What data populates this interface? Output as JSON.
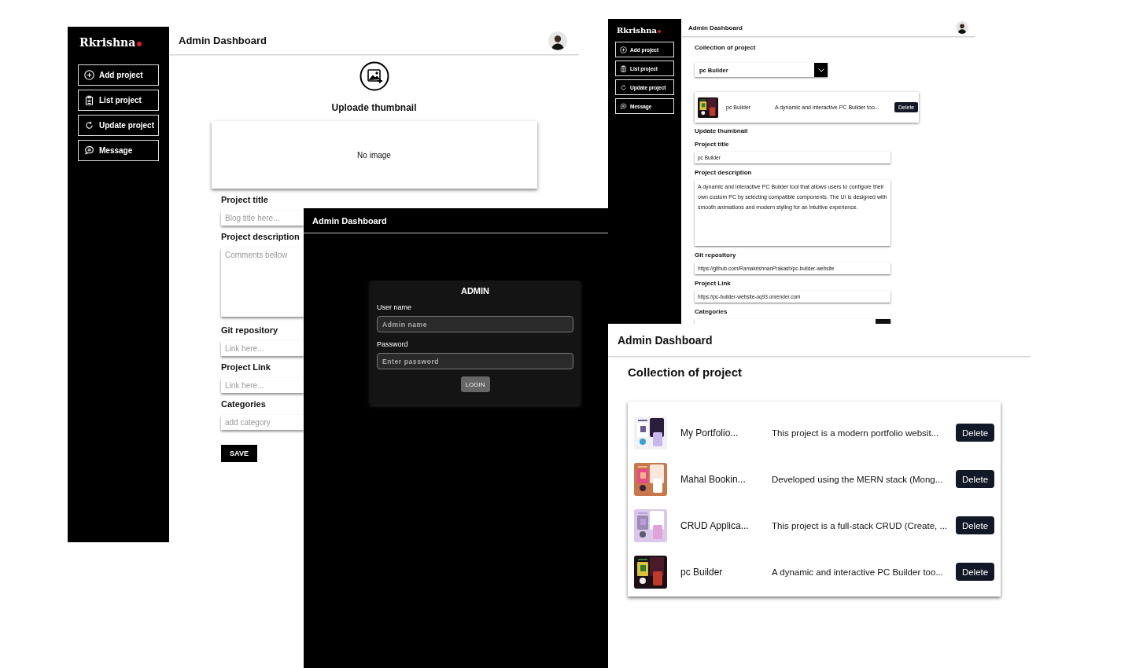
{
  "add_project_screen": {
    "brand": "Rkrishna",
    "sidebar": {
      "items": [
        {
          "label": "Add project"
        },
        {
          "label": "List project"
        },
        {
          "label": "Update project"
        },
        {
          "label": "Message"
        }
      ]
    },
    "title": "Admin Dashboard",
    "upload_label": "Uploade thumbnail",
    "preview": "No image",
    "fields": [
      {
        "label": "Project title",
        "placeholder": "Blog title here...",
        "kind": "input"
      },
      {
        "label": "Project description",
        "placeholder": "Comments bellow",
        "kind": "textarea"
      },
      {
        "label": "Git repository",
        "placeholder": "Link here...",
        "kind": "input"
      },
      {
        "label": "Project Link",
        "placeholder": "Link here...",
        "kind": "input"
      },
      {
        "label": "Categories",
        "placeholder": "add category",
        "kind": "input"
      }
    ],
    "save_button": "SAVE"
  },
  "login_screen": {
    "title": "Admin Dashboard",
    "heading": "ADMIN",
    "fields": [
      {
        "label": "User name",
        "placeholder": "Admin name"
      },
      {
        "label": "Password",
        "placeholder": "Enter password"
      }
    ],
    "button": "LOGIN"
  },
  "update_screen": {
    "brand": "Rkrishna",
    "sidebar": {
      "items": [
        {
          "label": "Add project"
        },
        {
          "label": "List project"
        },
        {
          "label": "Update project"
        },
        {
          "label": "Message"
        }
      ]
    },
    "title": "Admin Dashboard",
    "section": "Collection of project",
    "select": {
      "value": "pc Builder"
    },
    "project_card": {
      "title": "pc Builder",
      "description": "A dynamic and interactive PC Builder too...",
      "button": "Delete"
    },
    "thumbnail_label": "Update thumbnail",
    "fields": [
      {
        "label": "Project title",
        "value": "pc Builder",
        "kind": "input"
      },
      {
        "label": "Project description",
        "value": "A dynamic and interactive PC Builder tool that allows users to configure their own custom PC by selecting compatible components. The UI is designed with smooth animations and modern styling for an intuitive experience.",
        "kind": "textarea"
      },
      {
        "label": "Git repository",
        "value": "https://github.com/RamakrishnanPrakash/pc-builder-website",
        "kind": "input"
      },
      {
        "label": "Project Link",
        "value": "https://pc-builder-website-oq93.onrender.com",
        "kind": "input"
      },
      {
        "label": "Categories",
        "kind": "category"
      }
    ]
  },
  "list_screen": {
    "title": "Admin Dashboard",
    "heading": "Collection of project",
    "projects": [
      {
        "title": "My Portfolio...",
        "description": "This project is a modern portfolio websit...",
        "button": "Delete"
      },
      {
        "title": "Mahal Bookin...",
        "description": "Developed using the MERN stack (Mong...",
        "button": "Delete"
      },
      {
        "title": "CRUD Applica...",
        "description": "This project is a full-stack CRUD (Create, ...",
        "button": "Delete"
      },
      {
        "title": "pc Builder",
        "description": "A dynamic and interactive PC Builder too...",
        "button": "Delete"
      }
    ]
  }
}
